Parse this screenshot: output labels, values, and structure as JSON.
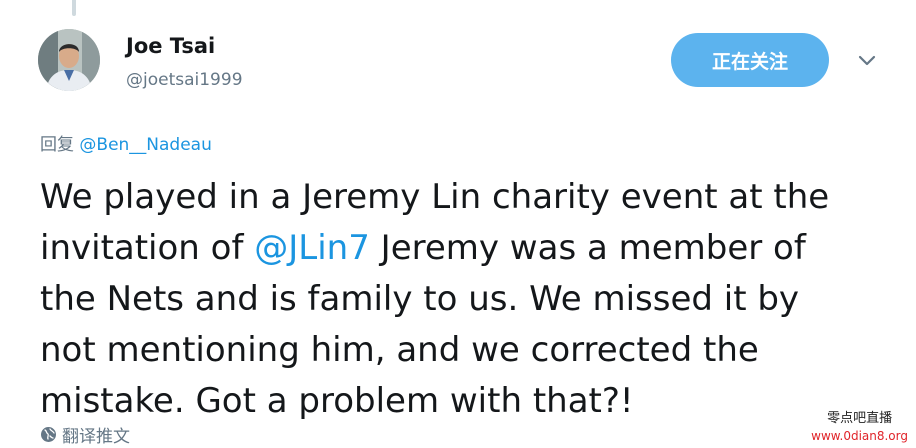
{
  "author": {
    "display_name": "Joe Tsai",
    "handle": "@joetsai1999"
  },
  "follow_button": {
    "label": "正在关注"
  },
  "reply": {
    "prefix": "回复",
    "mention": "@Ben__Nadeau"
  },
  "tweet": {
    "line1": "We played in a Jeremy Lin charity event at the",
    "line2_before": "invitation of ",
    "line2_mention": "@JLin7",
    "line2_after": " Jeremy was a member of",
    "line3": "the Nets and is family to us. We missed it by",
    "line4": "not mentioning him, and we corrected the",
    "line5": "mistake. Got a problem with that?!"
  },
  "translate": {
    "label": "翻译推文"
  },
  "watermark": {
    "name": "零点吧直播",
    "url": "www.0dian8.org"
  },
  "colors": {
    "accent": "#1b95e0",
    "follow_button_bg": "#5cb3ee",
    "secondary_text": "#657786"
  },
  "icons": [
    "caret-down-icon",
    "globe-icon"
  ]
}
